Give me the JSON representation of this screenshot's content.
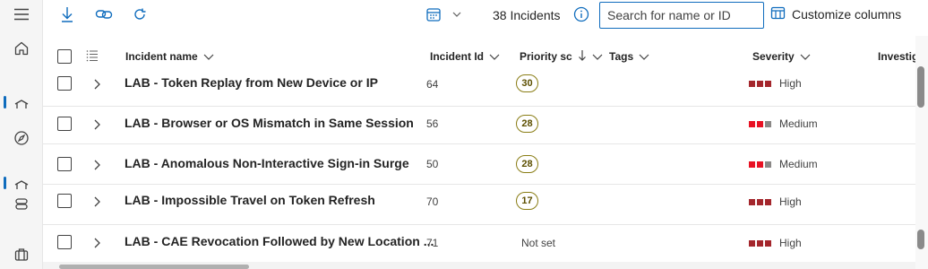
{
  "toolbar": {
    "count_text": "38 Incidents",
    "search_placeholder": "Search for name or ID",
    "customize_label": "Customize columns"
  },
  "columns": {
    "name": "Incident name",
    "id": "Incident Id",
    "priority": "Priority sc",
    "tags": "Tags",
    "severity": "Severity",
    "investigation": "Investig"
  },
  "rows": [
    {
      "name": "LAB - Token Replay from New Device or IP",
      "id": "64",
      "priority": "30",
      "severity": "High"
    },
    {
      "name": "LAB - Browser or OS Mismatch in Same Session",
      "id": "56",
      "priority": "28",
      "severity": "Medium"
    },
    {
      "name": "LAB - Anomalous Non-Interactive Sign-in Surge",
      "id": "50",
      "priority": "28",
      "severity": "Medium"
    },
    {
      "name": "LAB - Impossible Travel on Token Refresh",
      "id": "70",
      "priority": "17",
      "severity": "High"
    },
    {
      "name": "LAB - CAE Revocation Followed by New Location ...",
      "id": "71",
      "priority": "Not set",
      "severity": "High"
    }
  ],
  "colors": {
    "accent": "#0f6cbd",
    "sev_high": "#a4262c",
    "sev_medium": "#e81123",
    "sev_off": "#8a8886"
  }
}
